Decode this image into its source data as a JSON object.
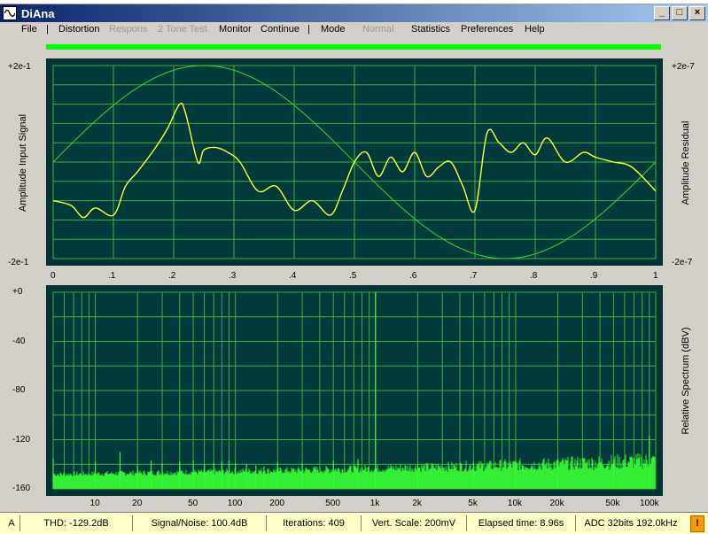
{
  "window": {
    "title": "DiAna"
  },
  "menu": [
    {
      "label": "File",
      "enabled": true
    },
    {
      "label": "Distortion",
      "enabled": true
    },
    {
      "label": "Respons",
      "enabled": false
    },
    {
      "label": "2 Tone Test",
      "enabled": false
    },
    {
      "label": "Monitor",
      "enabled": true
    },
    {
      "label": "Continue",
      "enabled": true
    },
    {
      "label": "Mode",
      "enabled": true
    },
    {
      "label": "Normal",
      "enabled": false
    },
    {
      "label": "Statistics",
      "enabled": true
    },
    {
      "label": "Preferences",
      "enabled": true
    },
    {
      "label": "Help",
      "enabled": true
    }
  ],
  "menu_separator": "|",
  "top_plot": {
    "y_top": "+2e-1",
    "y_bottom": "-2e-1",
    "y_right_top": "+2e-7",
    "y_right_bottom": "-2e-7",
    "ylabel_left": "Amplitude Input Signal",
    "ylabel_right": "Amplitude Residual",
    "xticks": [
      "0",
      ".1",
      ".2",
      ".3",
      ".4",
      ".5",
      ".6",
      ".7",
      ".8",
      ".9",
      "1"
    ]
  },
  "bottom_plot": {
    "yticks": [
      "+0",
      "-40",
      "-80",
      "-120",
      "-160"
    ],
    "ylabel_right": "Relative Spectrum (dBV)",
    "xticks": [
      "10",
      "20",
      "50",
      "100",
      "200",
      "500",
      "1k",
      "2k",
      "5k",
      "10k",
      "20k",
      "50k",
      "100k"
    ]
  },
  "chart_data": [
    {
      "type": "line",
      "xlim": [
        0,
        1
      ],
      "grid": true,
      "series": [
        {
          "color": "#33dd33",
          "x": [
            0,
            0.05,
            0.1,
            0.15,
            0.2,
            0.25,
            0.3,
            0.35,
            0.4,
            0.45,
            0.5,
            0.55,
            0.6,
            0.65,
            0.7,
            0.75,
            0.8,
            0.85,
            0.9,
            0.95,
            1.0
          ],
          "y": [
            0,
            0.06,
            0.118,
            0.162,
            0.19,
            0.2,
            0.19,
            0.162,
            0.118,
            0.062,
            0,
            -0.062,
            -0.118,
            -0.162,
            -0.19,
            -0.2,
            -0.19,
            -0.162,
            -0.118,
            -0.062,
            0
          ]
        },
        {
          "color": "#ffff33",
          "x": [
            0,
            0.03,
            0.05,
            0.07,
            0.1,
            0.12,
            0.14,
            0.17,
            0.19,
            0.21,
            0.22,
            0.24,
            0.25,
            0.27,
            0.29,
            0.31,
            0.34,
            0.37,
            0.4,
            0.43,
            0.46,
            0.48,
            0.5,
            0.52,
            0.54,
            0.56,
            0.58,
            0.6,
            0.62,
            0.64,
            0.66,
            0.68,
            0.7,
            0.72,
            0.74,
            0.76,
            0.78,
            0.8,
            0.82,
            0.85,
            0.88,
            0.9,
            0.93,
            0.96,
            1.0
          ],
          "y": [
            -0.08,
            -0.09,
            -0.115,
            -0.095,
            -0.11,
            -0.05,
            -0.02,
            0.03,
            0.07,
            0.12,
            0.1,
            0.0,
            0.025,
            0.03,
            0.02,
            0.0,
            -0.06,
            -0.05,
            -0.1,
            -0.08,
            -0.11,
            -0.06,
            0.0,
            0.02,
            -0.03,
            0.01,
            -0.02,
            0.02,
            -0.03,
            -0.01,
            0.0,
            -0.05,
            -0.1,
            0.06,
            0.04,
            0.02,
            0.04,
            0.015,
            0.05,
            0.0,
            0.02,
            0.01,
            0.0,
            -0.01,
            -0.06
          ]
        }
      ]
    },
    {
      "type": "bar",
      "xscale": "log",
      "xlim": [
        5,
        100000
      ],
      "ylim": [
        -160,
        0
      ],
      "grid": true,
      "series": [
        {
          "name": "harmonics",
          "color": "#33ff33",
          "x": [
            5,
            10,
            15,
            20,
            25,
            30,
            40,
            50,
            60,
            70,
            80,
            90,
            100,
            120,
            140,
            160,
            200,
            300,
            500,
            750,
            1000,
            2000,
            5000,
            10000,
            20000,
            50000,
            90000
          ],
          "y": [
            -135,
            -138,
            -130,
            -140,
            -137,
            -139,
            -138,
            -137,
            -140,
            -139,
            -138,
            -137,
            -139,
            -140,
            -141,
            -142,
            -138,
            -139,
            -137,
            -136,
            0,
            -140,
            -138,
            -141,
            -137,
            -139,
            -117
          ]
        }
      ],
      "noise_floor": -150
    }
  ],
  "status": {
    "mode": "A",
    "thd": "THD: -129.2dB",
    "snr": "Signal/Noise:  100.4dB",
    "iterations": "Iterations: 409",
    "vscale": "Vert. Scale: 200mV",
    "elapsed": "Elapsed time: 8.96s",
    "adc": "ADC 32bits 192.0kHz",
    "warn": "!"
  }
}
